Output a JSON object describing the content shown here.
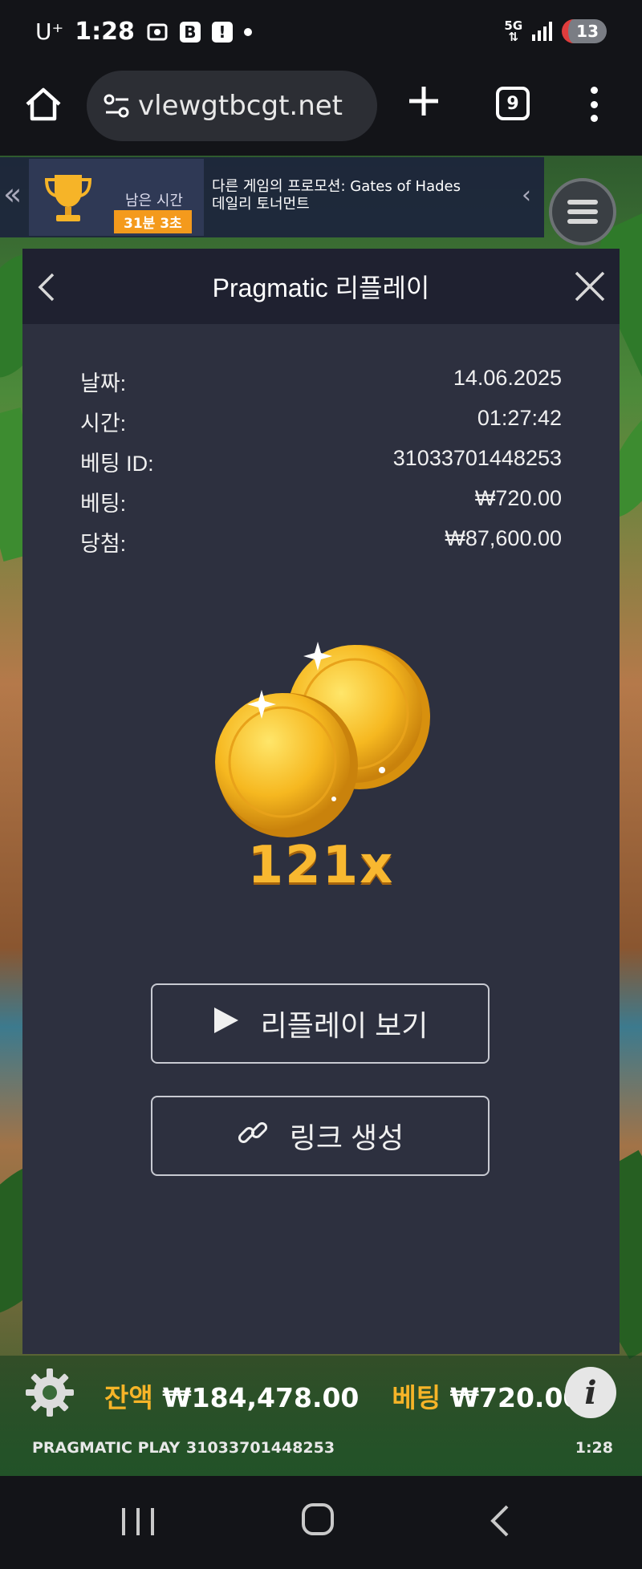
{
  "status_bar": {
    "carrier": "U⁺",
    "time": "1:28",
    "network": "5G",
    "notification_count": "13"
  },
  "browser": {
    "url": "vlewgtbcgt.net",
    "tab_count": "9"
  },
  "promo": {
    "remaining_label": "남은 시간",
    "remaining_time": "31분 3초",
    "line1": "다른 게임의 프로모션: Gates of Hades",
    "line2": "데일리 토너먼트"
  },
  "replay_panel": {
    "title": "Pragmatic 리플레이",
    "details": [
      {
        "label": "날짜:",
        "value": "14.06.2025"
      },
      {
        "label": "시간:",
        "value": "01:27:42"
      },
      {
        "label": "베팅 ID:",
        "value": "31033701448253"
      },
      {
        "label": "베팅:",
        "value": "₩720.00"
      },
      {
        "label": "당첨:",
        "value": "₩87,600.00"
      }
    ],
    "multiplier": "121x",
    "replay_button": "리플레이 보기",
    "link_button": "링크 생성"
  },
  "game_bar": {
    "balance_label": "잔액",
    "balance_value": "₩184,478.00",
    "bet_label": "베팅",
    "bet_value": "₩720.00",
    "brand": "PRAGMATIC PLAY",
    "bet_id": "31033701448253",
    "clock": "1:28"
  },
  "colors": {
    "panel_bg": "#2d303f",
    "panel_header": "#1f2130",
    "gold": "#f6b428",
    "timer_badge": "#f49a1c"
  }
}
